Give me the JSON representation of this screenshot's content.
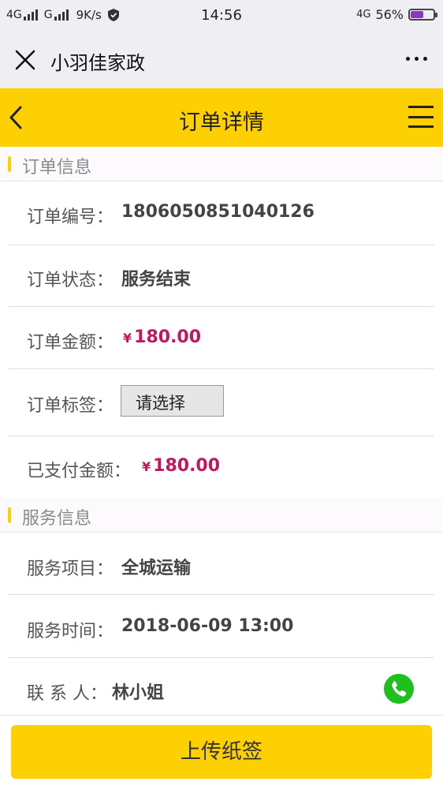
{
  "status_bar": {
    "network1": "4G",
    "network2": "G",
    "speed": "9K/s",
    "time": "14:56",
    "network_right": "4G",
    "battery_pct": "56%",
    "battery_level": 0.56,
    "battery_color": "#8a35c9"
  },
  "wechat_bar": {
    "title": "小羽佳家政",
    "close_icon": "close-icon",
    "more_icon": "more-dots-icon"
  },
  "header": {
    "title": "订单详情",
    "back_icon": "chevron-left-icon",
    "menu_icon": "hamburger-menu-icon",
    "color": "#fdd004"
  },
  "order_section": {
    "title": "订单信息",
    "order_no_label": "订单编号：",
    "order_no": "1806050851040126",
    "status_label": "订单状态：",
    "status": "服务结束",
    "amount_label": "订单金额：",
    "amount_currency": "¥",
    "amount": "180.00",
    "tag_label": "订单标签：",
    "tag_select": "请选择",
    "paid_label": "已支付金额：",
    "paid_currency": "¥",
    "paid": "180.00"
  },
  "service_section": {
    "title": "服务信息",
    "item_label": "服务项目：",
    "item": "全城运输",
    "time_label": "服务时间：",
    "time": "2018-06-09 13:00",
    "contact_label": "联 系 人：",
    "contact": "林小姐",
    "phone_icon": "phone-icon"
  },
  "upload_button": {
    "label": "上传纸签"
  },
  "colors": {
    "accent": "#fdd004",
    "money": "#c2185b",
    "phone": "#1fbf1f"
  }
}
